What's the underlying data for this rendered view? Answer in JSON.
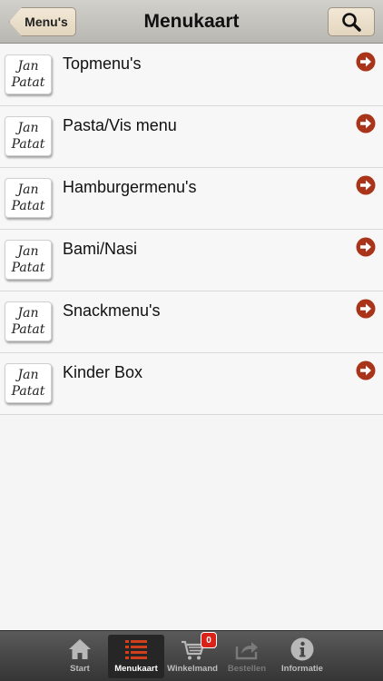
{
  "navbar": {
    "back_label": "Menu's",
    "title": "Menukaart",
    "search_icon": "search-icon"
  },
  "menu": {
    "logo_line1": "Jan",
    "logo_line2": "Patat",
    "items": [
      {
        "label": "Topmenu's"
      },
      {
        "label": "Pasta/Vis menu"
      },
      {
        "label": "Hamburgermenu's"
      },
      {
        "label": "Bami/Nasi"
      },
      {
        "label": "Snackmenu's"
      },
      {
        "label": "Kinder Box"
      }
    ]
  },
  "tabbar": {
    "tabs": [
      {
        "label": "Start",
        "icon": "home-icon"
      },
      {
        "label": "Menukaart",
        "icon": "list-icon",
        "active": true
      },
      {
        "label": "Winkelmand",
        "icon": "cart-icon",
        "badge": "0"
      },
      {
        "label": "Bestellen",
        "icon": "share-icon",
        "disabled": true
      },
      {
        "label": "Informatie",
        "icon": "info-icon"
      }
    ]
  },
  "colors": {
    "arrow": "#a9341a",
    "navbar": "#c4c2bc",
    "tabbar": "#454545",
    "badge": "#d9231a"
  }
}
